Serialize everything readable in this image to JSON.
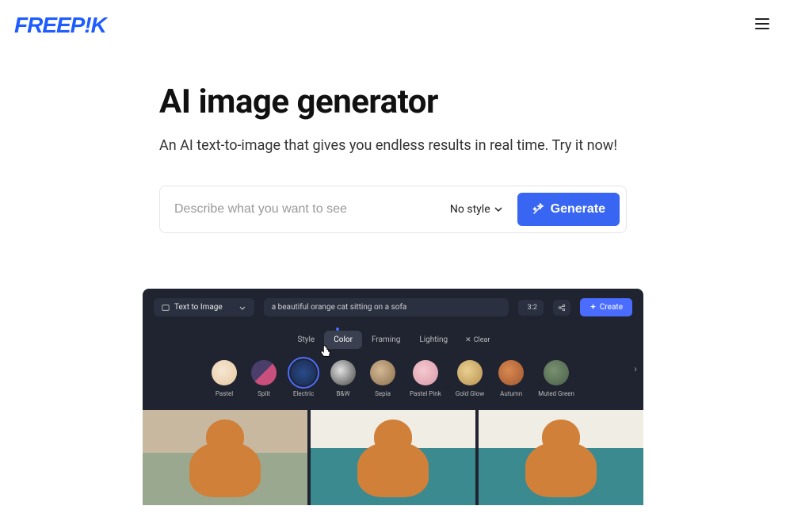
{
  "header": {
    "logo": "FREEP!K"
  },
  "hero": {
    "title": "AI image generator",
    "subtitle": "An AI text-to-image that gives you endless results in real time. Try it now!",
    "placeholder": "Describe what you want to see",
    "style_select": "No style",
    "generate": "Generate"
  },
  "preview": {
    "mode": "Text to Image",
    "prompt": "a beautiful orange cat sitting on a sofa",
    "ratio": "3:2",
    "create": "Create",
    "tabs": {
      "style": "Style",
      "color": "Color",
      "framing": "Framing",
      "lighting": "Lighting",
      "clear": "Clear"
    },
    "styles": [
      {
        "key": "pastel",
        "label": "Pastel"
      },
      {
        "key": "split",
        "label": "Split"
      },
      {
        "key": "electric",
        "label": "Electric"
      },
      {
        "key": "bw",
        "label": "B&W"
      },
      {
        "key": "sepia",
        "label": "Sepia"
      },
      {
        "key": "pink",
        "label": "Pastel Pink"
      },
      {
        "key": "gold",
        "label": "Gold Glow"
      },
      {
        "key": "autumn",
        "label": "Autumn"
      },
      {
        "key": "muted",
        "label": "Muted Green"
      }
    ]
  }
}
